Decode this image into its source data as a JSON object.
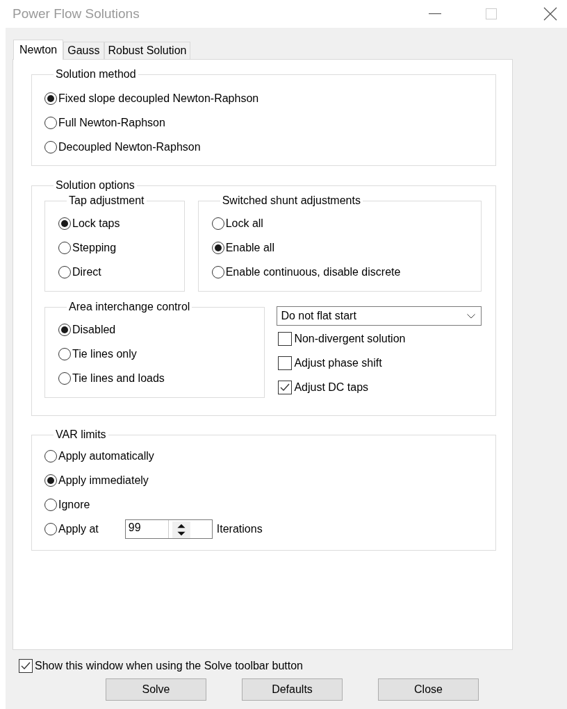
{
  "window": {
    "title": "Power Flow Solutions"
  },
  "tabs": [
    {
      "label": "Newton",
      "selected": true
    },
    {
      "label": "Gauss",
      "selected": false
    },
    {
      "label": "Robust Solution",
      "selected": false
    }
  ],
  "solution_method": {
    "title": "Solution method",
    "options": [
      {
        "label": "Fixed slope decoupled Newton-Raphson",
        "selected": true
      },
      {
        "label": "Full Newton-Raphson",
        "selected": false
      },
      {
        "label": "Decoupled Newton-Raphson",
        "selected": false
      }
    ]
  },
  "solution_options": {
    "title": "Solution options",
    "tap_adjustment": {
      "title": "Tap adjustment",
      "options": [
        {
          "label": "Lock taps",
          "selected": true
        },
        {
          "label": "Stepping",
          "selected": false
        },
        {
          "label": "Direct",
          "selected": false
        }
      ]
    },
    "switched_shunt_adjustments": {
      "title": "Switched shunt adjustments",
      "options": [
        {
          "label": "Lock all",
          "selected": false
        },
        {
          "label": "Enable all",
          "selected": true
        },
        {
          "label": "Enable continuous, disable discrete",
          "selected": false
        }
      ]
    },
    "area_interchange_control": {
      "title": "Area interchange control",
      "options": [
        {
          "label": "Disabled",
          "selected": true
        },
        {
          "label": "Tie lines only",
          "selected": false
        },
        {
          "label": "Tie lines and loads",
          "selected": false
        }
      ]
    },
    "flat_start": {
      "value": "Do not flat start"
    },
    "checkboxes": [
      {
        "label": "Non-divergent solution",
        "checked": false
      },
      {
        "label": "Adjust phase shift",
        "checked": false
      },
      {
        "label": "Adjust DC taps",
        "checked": true
      }
    ]
  },
  "var_limits": {
    "title": "VAR limits",
    "options": [
      {
        "label": "Apply automatically",
        "selected": false,
        "kind": "plain"
      },
      {
        "label": "Apply immediately",
        "selected": true,
        "kind": "plain"
      },
      {
        "label": "Ignore",
        "selected": false,
        "kind": "plain"
      },
      {
        "label": "Apply at",
        "selected": false,
        "kind": "iterations"
      }
    ],
    "iterations": {
      "value": "99",
      "unit": "Iterations"
    }
  },
  "show_window": {
    "label": "Show this window when using the Solve toolbar button",
    "checked": true
  },
  "buttons": [
    "Solve",
    "Defaults",
    "Close"
  ]
}
